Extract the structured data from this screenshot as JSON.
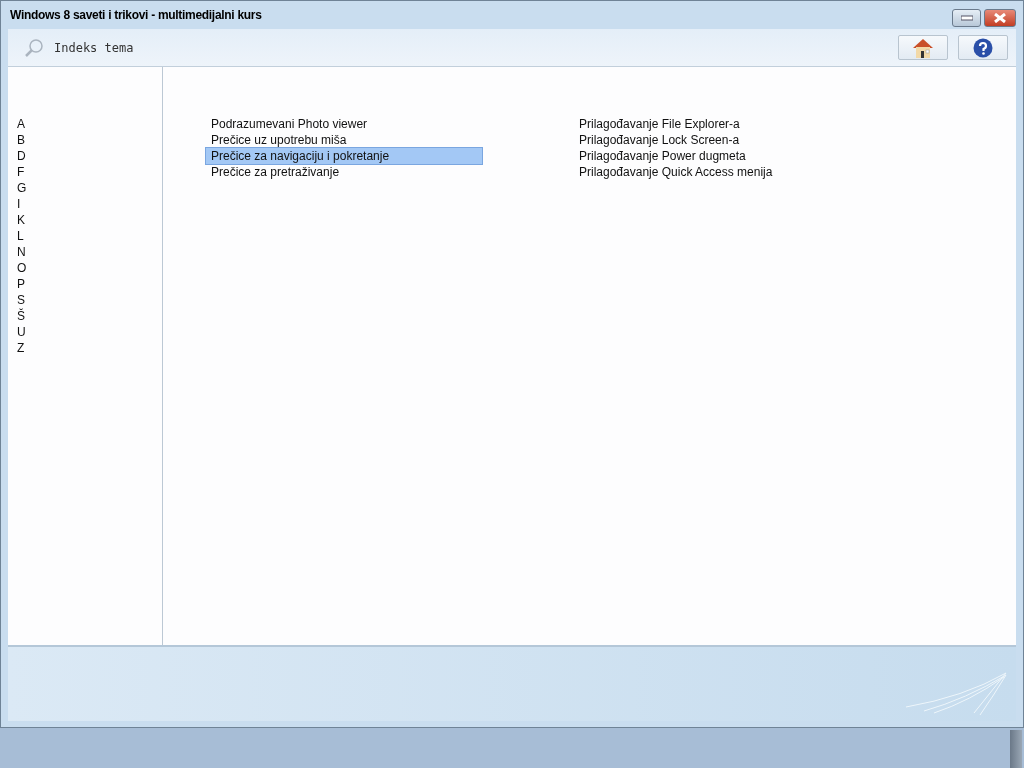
{
  "window": {
    "title": "Windows 8 saveti i trikovi - multimedijalni kurs"
  },
  "toolbar": {
    "title": "Indeks tema"
  },
  "letters": [
    "A",
    "B",
    "D",
    "F",
    "G",
    "I",
    "K",
    "L",
    "N",
    "O",
    "P",
    "S",
    "Š",
    "U",
    "Z"
  ],
  "topic_columns": [
    [
      {
        "label": "Podrazumevani Photo viewer",
        "selected": false
      },
      {
        "label": "Prečice uz upotrebu miša",
        "selected": false
      },
      {
        "label": "Prečice za navigaciju i pokretanje",
        "selected": true
      },
      {
        "label": "Prečice za pretraživanje",
        "selected": false
      }
    ],
    [
      {
        "label": "Prilagođavanje File Explorer-a",
        "selected": false
      },
      {
        "label": "Prilagođavanje Lock Screen-a",
        "selected": false
      },
      {
        "label": "Prilagođavanje Power dugmeta",
        "selected": false
      },
      {
        "label": "Prilagođavanje Quick Access menija",
        "selected": false
      }
    ]
  ]
}
